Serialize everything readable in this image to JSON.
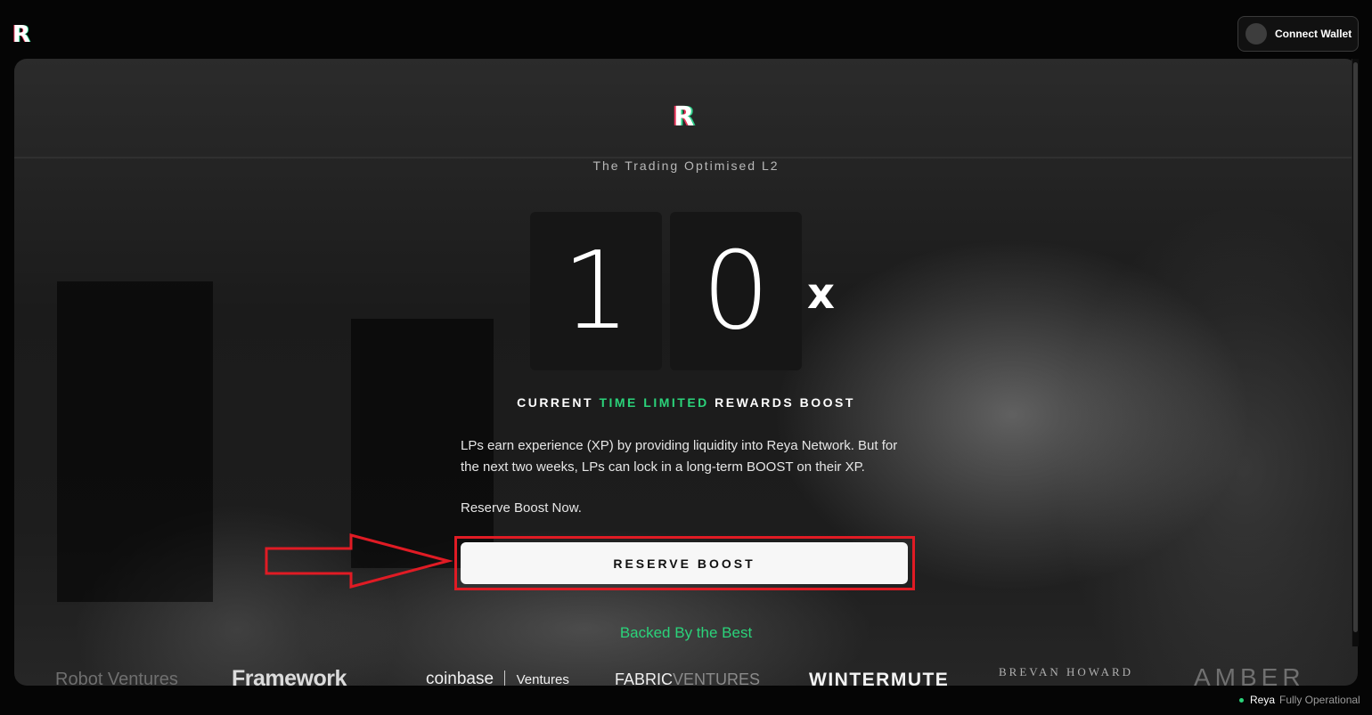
{
  "header": {
    "logo": "R",
    "wallet_button": "Connect Wallet"
  },
  "hero": {
    "logo": "R",
    "tagline": "The Trading Optimised L2",
    "boost_digits": [
      "1",
      "0"
    ],
    "boost_suffix": "x",
    "boost_title": {
      "prefix": "CURRENT ",
      "highlight": "TIME LIMITED",
      "suffix": " REWARDS BOOST"
    },
    "description": "LPs earn experience (XP) by providing liquidity into Reya Network. But for the next two weeks, LPs can lock in a long-term BOOST on their XP.",
    "call_to_action": "Reserve Boost Now.",
    "reserve_button": "RESERVE BOOST",
    "backed_by": "Backed By the Best"
  },
  "backers": [
    {
      "name": "Robot Ventures",
      "text": "Robot Ventures"
    },
    {
      "name": "Framework",
      "text": "Framework"
    },
    {
      "name": "Coinbase Ventures",
      "text_a": "coinbase",
      "text_b": "Ventures"
    },
    {
      "name": "Fabric Ventures",
      "text_a": "FABRIC",
      "text_b": "VENTURES"
    },
    {
      "name": "Wintermute",
      "text": "WINTERMUTE"
    },
    {
      "name": "Brevan Howard",
      "text": "BREVAN HOWARD"
    },
    {
      "name": "Amber",
      "text": "AMBER"
    }
  ],
  "status": {
    "name": "Reya",
    "text": "Fully Operational"
  },
  "colors": {
    "accent_green": "#2bd37a",
    "annotation_red": "#e01b24"
  }
}
